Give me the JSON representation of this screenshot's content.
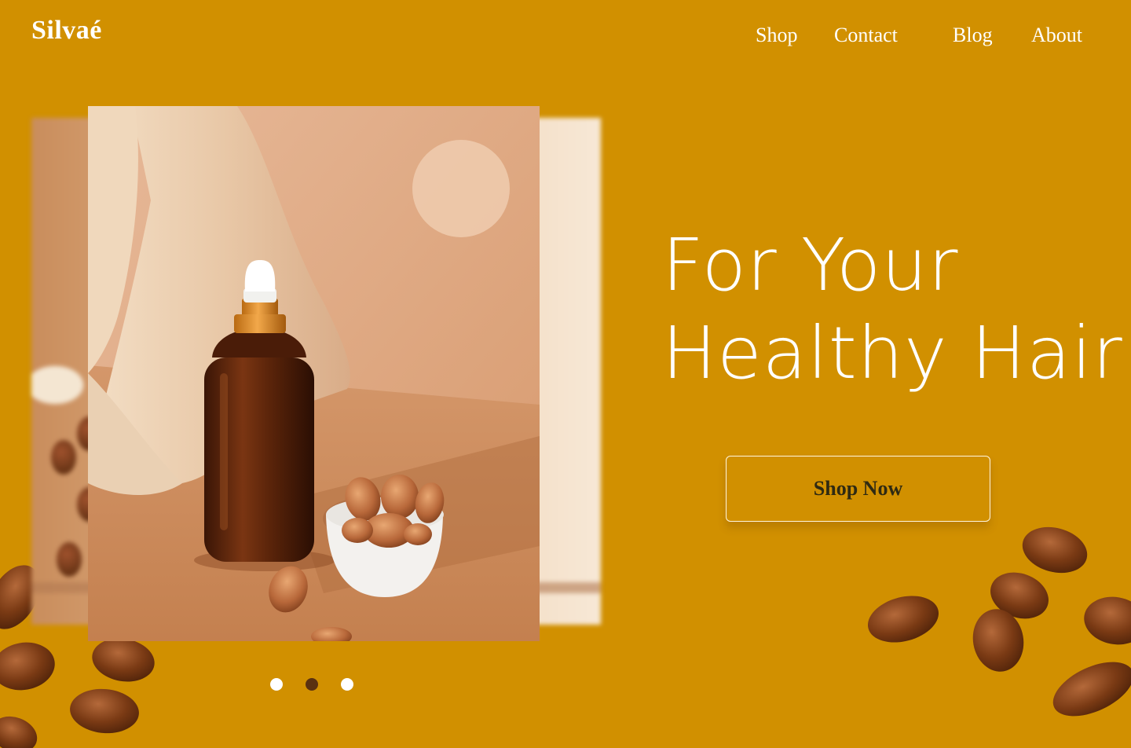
{
  "brand": {
    "name": "Silvaé"
  },
  "nav": {
    "items": [
      "Shop",
      "Contact",
      "Blog",
      "About"
    ]
  },
  "hero": {
    "headline_line1": "For Your",
    "headline_line2": "Healthy Hair",
    "cta_label": "Shop Now"
  },
  "carousel": {
    "slide_count": 3,
    "active_index": 1
  },
  "colors": {
    "background": "#D19000",
    "text": "#FFFFFF",
    "cta_text": "#2F2A12",
    "dot_active": "#5A3111",
    "dot_inactive": "#FFFFFF"
  }
}
